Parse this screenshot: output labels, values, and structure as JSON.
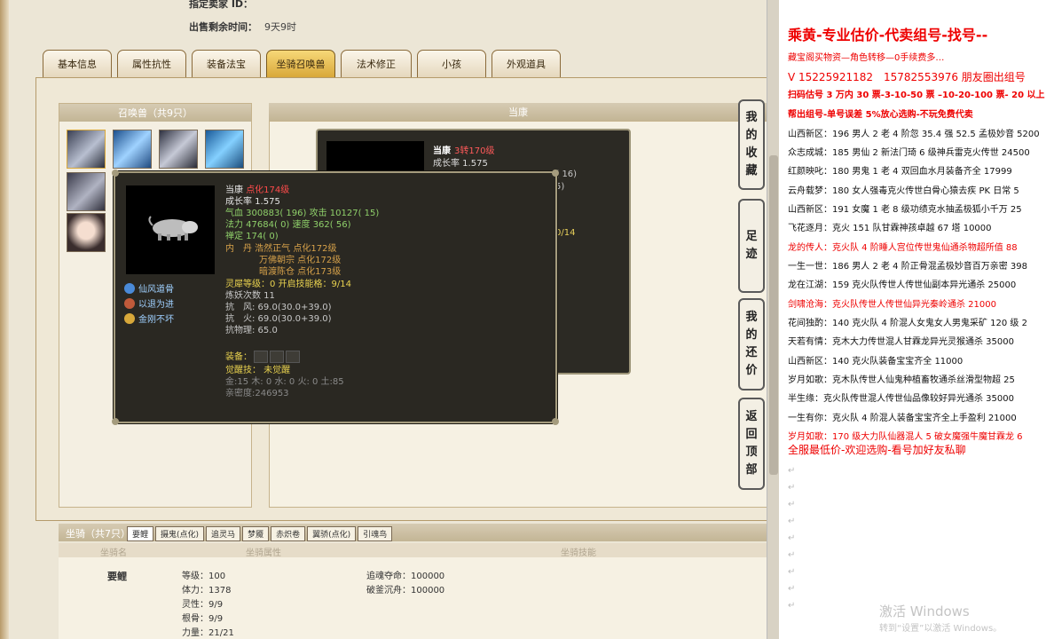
{
  "top": {
    "seller_id_label": "指定卖家 ID：",
    "time_left_label": "出售剩余时间：",
    "time_left_value": "9天9时"
  },
  "tabs": [
    "基本信息",
    "属性抗性",
    "装备法宝",
    "坐骑召唤兽",
    "法术修正",
    "小孩",
    "外观道具"
  ],
  "summon": {
    "header": "召唤兽（共9只）",
    "detail_header": "当康"
  },
  "tooltip_back": {
    "name": "当康",
    "level": "3转170级",
    "growth": "成长率 1.575",
    "frag1": "9( 16)",
    "frag2": "5)",
    "frag3": "0/14"
  },
  "tooltip": {
    "name": "当康",
    "level": "点化174级",
    "growth": "成长率 1.575",
    "hp": "气血 300883( 196) 攻击 10127( 15)",
    "mp": "法力 47684( 0) 速度 362( 56)",
    "poise": "禅定 174( 0)",
    "neidan1": "内　丹 浩然正气 点化172级",
    "neidan2": "万佛朝宗 点化172级",
    "neidan3": "暗渡陈仓 点化173级",
    "spirit": "灵犀等级：0 开启技能格：9/14",
    "refine": "炼妖次数 11",
    "wind": "抗　风: 69.0(30.0+39.0)",
    "fire": "抗　火: 69.0(30.0+39.0)",
    "physical": "抗物理: 65.0",
    "equip": "装备：",
    "awaken": "觉醒技： 未觉醒",
    "elements": "金:15 木: 0 水: 0 火: 0 土:85",
    "intimacy": "亲密度:246953",
    "skills": [
      "仙风道骨",
      "以退为进",
      "金刚不坏"
    ]
  },
  "side_buttons": [
    [
      "我",
      "的",
      "收",
      "藏"
    ],
    [
      "足",
      "迹"
    ],
    [
      "我",
      "的",
      "还",
      "价"
    ],
    [
      "返",
      "回",
      "顶",
      "部"
    ]
  ],
  "mount": {
    "title": "坐骑（共7只）",
    "tabs": [
      "要鲤",
      "摄鬼(点化)",
      "追灵马",
      "梦魇",
      "赤炽卷",
      "翼骄(点化)",
      "引魂鸟"
    ],
    "sub_name": "坐骑名",
    "sub_attr": "坐骑属性",
    "sub_skill": "坐骑技能",
    "name": "要鲤",
    "stats": [
      "等级：100",
      "体力：1378",
      "灵性：9/9",
      "根骨：9/9",
      "力量：21/21"
    ],
    "skill1": "追魂夺命：100000",
    "skill2": "破釜沉舟：100000"
  },
  "right": {
    "title": "乘黄-专业估价-代卖组号-找号--",
    "lines": [
      {
        "text": "藏宝阁买物资—角色转移—0手续费多…",
        "style": "red"
      },
      {
        "text": "V 15225921182　15782553976 朋友圈出组号",
        "style": "red big"
      },
      {
        "text": "扫码估号 3 万内 30 票-3-10-50 票 –10-20-100 票- 20 以上",
        "style": "redb"
      },
      {
        "text": "帮出组号-单号误差 5%放心选购-不玩免费代卖",
        "style": "redb"
      },
      {
        "text": "山西新区：196 男人 2 老 4 阶忽 35.4 强 52.5 孟极妙音 5200",
        "style": ""
      },
      {
        "text": "众志成城：185 男仙 2 新法门琦 6 级神兵雷克火传世 24500",
        "style": ""
      },
      {
        "text": "红颜映叱：180 男鬼 1 老 4 双回血水月装备齐全 17999",
        "style": ""
      },
      {
        "text": "云舟载梦：180 女人强毒克火传世白骨心猿去疾 PK 日常 5",
        "style": ""
      },
      {
        "text": "山西新区：191 女魔 1 老 8 级功绩克水抽孟极狐小千万 25",
        "style": ""
      },
      {
        "text": "飞花逐月：克火 151 队甘霖神孩卓越 67 塔 10000",
        "style": ""
      },
      {
        "text": "龙的传人：克火队 4 阶睡人宫位传世鬼仙通杀物超所值 88",
        "style": "red"
      },
      {
        "text": "一生一世：186 男人 2 老 4 阶正骨混孟极妙音百万亲密 398",
        "style": ""
      },
      {
        "text": "龙在江湖：159 克火队传世人传世仙副本异光通杀 25000",
        "style": ""
      },
      {
        "text": "剑啸沧海：克火队传世人传世仙异光秦岭通杀 21000",
        "style": "red"
      },
      {
        "text": "花间独酌：140 克火队 4 阶混人女鬼女人男鬼采矿 120 级 2",
        "style": ""
      },
      {
        "text": "天若有情：克木大力传世混人甘霖龙异光灵猴通杀 35000",
        "style": ""
      },
      {
        "text": "山西新区：140 克火队装备宝宝齐全 11000",
        "style": ""
      },
      {
        "text": "岁月如歌：克木队传世人仙鬼种植畜牧通杀丝滑型物超 25",
        "style": ""
      },
      {
        "text": "半生缘：克火队传世混人传世仙品像较好异光通杀 35000",
        "style": ""
      },
      {
        "text": "一生有你：克火队 4 阶混人装备宝宝齐全上手盈利 21000",
        "style": ""
      },
      {
        "text": "岁月如歌：170 级大力队仙器混人 5 破女魔强牛魔甘霖龙 6",
        "style": "red"
      },
      {
        "text": "全服最低价-欢迎选购-看号加好友私聊",
        "style": "red big"
      }
    ],
    "watermark": "激活 Windows",
    "watermark_sub": "转到“设置”以激活 Windows。"
  }
}
